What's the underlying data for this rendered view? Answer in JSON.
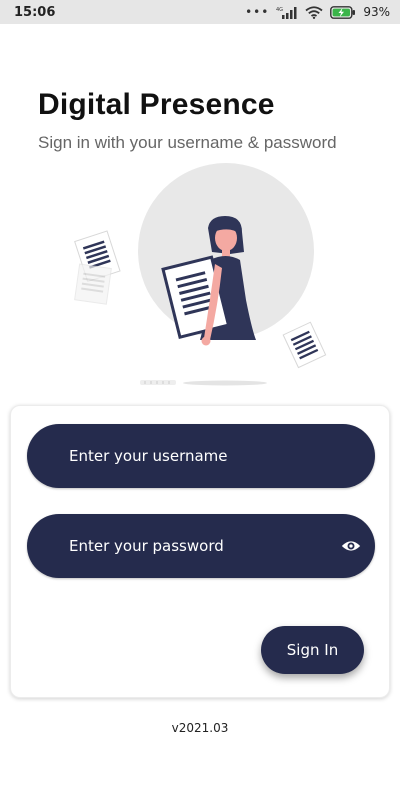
{
  "status_bar": {
    "time": "15:06",
    "dots": "•••",
    "network": "4G",
    "battery_percent": "93%"
  },
  "header": {
    "title": "Digital Presence",
    "subtitle": "Sign in with your username & password"
  },
  "illustration": {
    "icon": "woman-with-documents-illustration"
  },
  "login_form": {
    "username_placeholder": "Enter your username",
    "password_placeholder": "Enter your password",
    "password_toggle_icon": "eye-icon",
    "sign_in_label": "Sign In"
  },
  "footer": {
    "version": "v2021.03"
  },
  "colors": {
    "primary": "#252b4d",
    "status_bar": "#e6e6e6",
    "background": "#ffffff"
  }
}
